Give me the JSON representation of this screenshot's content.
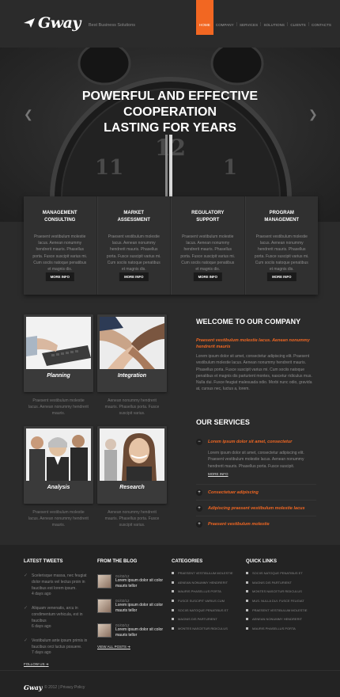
{
  "header": {
    "logo": "Gway",
    "tagline": "Best Business Solutions",
    "nav": [
      "HOME",
      "COMPANY",
      "SERVICES",
      "SOLUTIONS",
      "CLIENTS",
      "CONTACTS"
    ]
  },
  "hero": {
    "title_lines": [
      "POWERFUL AND EFFECTIVE",
      "COOPERATION",
      "LASTING FOR YEARS"
    ],
    "prev": "❮",
    "next": "❯"
  },
  "services_boxes": [
    {
      "title": [
        "MANAGEMENT",
        "CONSULTING"
      ],
      "text": "Praesent vestibulum molestie lacus. Aenean nonummy hendrerit mauris. Phasellus porta. Fusce suscipit varius mi. Cum sociis natoque penatibus et magnis dis.",
      "button": "MORE INFO"
    },
    {
      "title": [
        "MARKET",
        "ASSESSMENT"
      ],
      "text": "Praesent vestibulum molestie lacus. Aenean nonummy hendrerit mauris. Phasellus porta. Fusce suscipit varius mi. Cum sociis natoque penatibus et magnis dis.",
      "button": "MORE INFO"
    },
    {
      "title": [
        "REGULATORY",
        "SUPPORT"
      ],
      "text": "Praesent vestibulum molestie lacus. Aenean nonummy hendrerit mauris. Phasellus porta. Fusce suscipit varius mi. Cum sociis natoque penatibus et magnis dis.",
      "button": "MORE INFO"
    },
    {
      "title": [
        "PROGRAM",
        "MANAGEMENT"
      ],
      "text": "Praesent vestibulum molestie lacus. Aenean nonummy hendrerit mauris. Phasellus porta. Fusce suscipit varius mi. Cum sociis natoque penatibus et magnis dis.",
      "button": "MORE INFO"
    }
  ],
  "features": [
    {
      "label": "Planning",
      "text": "Praesent vestibulum molestie lacus. Aenean nonummy hendrerit mauris."
    },
    {
      "label": "Integration",
      "text": "Aenean nonummy hendrerit mauris. Phasellus porta. Fusce suscipit varius."
    },
    {
      "label": "Analysis",
      "text": "Praesent vestibulum molestie lacus. Aenean nonummy hendrerit mauris."
    },
    {
      "label": "Research",
      "text": "Aenean nonummy hendrerit mauris. Phasellus porta. Fusce suscipit varius."
    }
  ],
  "welcome": {
    "title": "WELCOME TO OUR COMPANY",
    "lead": "Praesent vestibulum molestie lacus. Aenean nonummy hendrerit mauris",
    "text": "Lorem ipsum dolor sit amet, consectetur adipiscing elit. Praesent vestibulum molestie lacus. Aenean nonummy hendrerit mauris. Phasellus porta. Fusce suscipit varius mi. Cum sociis natoque penatibus et magnis dis parturient montes, nascetur ridiculus mus. Nulla dui. Fusce feugiat malesuada odio. Morbi nunc odio, gravida at, cursus nec, luctus a, lorem."
  },
  "our_services": {
    "title": "OUR SERVICES",
    "open_item": {
      "label": "Lorem ipsum dolor sit amet, consectetur",
      "text": "Lorem ipsum dolor sit amet, consectetur adipiscing elit. Praesent vestibulum molestie lacus. Aenean nonummy hendrerit mauris. Phasellus porta. Fusce suscipit.",
      "more": "MORE INFO"
    },
    "items": [
      "Consectetuer adipiscing",
      "Adipiscing praesent vestibulum molestie lacus",
      "Praesent vestibulum molestie"
    ]
  },
  "footer": {
    "tweets_title": "LATEST TWEETS",
    "tweets": [
      {
        "text": "Scelerisque massa, nec feugiat dolor mauris vel lectus proin in faucibus est lorem ipsum.",
        "time": "4 days ago"
      },
      {
        "text": "Aliquam venenatis, arcu in condimentum vehicula, est in faucibus",
        "time": "6 days ago"
      },
      {
        "text": "Vestibulum ante ipsum primis in faucibus orci luctus posuere.",
        "time": "7 days ago"
      }
    ],
    "follow": "FOLLOW US",
    "blog_title": "FROM THE BLOG",
    "blog": [
      {
        "date": "01/02/12",
        "title": "Lorem ipsum dolor sit color mauris tellor"
      },
      {
        "date": "01/02/12",
        "title": "Lorem ipsum dolor sit color mauris tellor"
      },
      {
        "date": "01/02/12",
        "title": "Lorem ipsum dolor sit color mauris tellor"
      }
    ],
    "view_posts": "VIEW ALL POSTS",
    "categories_title": "CATEGORIES",
    "categories": [
      "PRAESENT VESTIBULUM MOLESTIE",
      "AENEAN NONUMMY HENDRERIT",
      "MAURIS PHASELLUS PORTA",
      "FUSCE SUSCIPIT VARIUS CUM",
      "SOCIIS NATOQUE PENATIBUS ET",
      "MAGNIS DIS PARTURIENT",
      "MONTES NASCETUR RIDICULUS"
    ],
    "quick_title": "QUICK LINKS",
    "quick": [
      "SOCIIS NATOQUE PENATIBUS ET",
      "MAGNIS DIS PARTURIENT",
      "MONTES NASCETUR RIDICULUS",
      "MUS. NULLA DUI. FUSCE FEUGIAT",
      "PRAESENT VESTIBULUM MOLESTIE",
      "AENEAN NONUMMY HENDRERIT",
      "MAURIS PHASELLUS PORTA"
    ],
    "bottom_logo": "Gway",
    "copyright": "© 2012 | Privacy Policy"
  },
  "colors": {
    "accent": "#f26722",
    "background": "#2b2b2b"
  }
}
